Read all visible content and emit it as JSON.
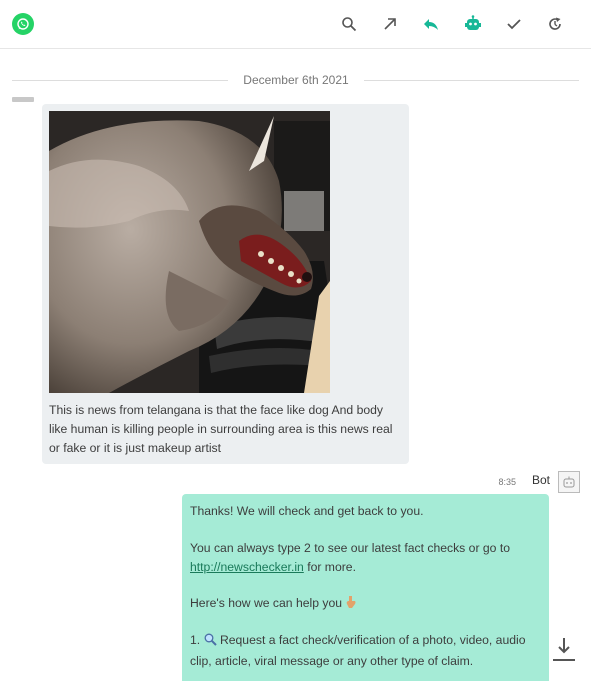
{
  "toolbar": {
    "app_icon": "whatsapp-icon",
    "icons": [
      "search-icon",
      "open-external-icon",
      "reply-icon",
      "bot-icon",
      "check-icon",
      "refresh-icon"
    ],
    "accent_color": "#25d366",
    "active_icon_color": "#17b897"
  },
  "conversation": {
    "date": "December 6th 2021",
    "incoming": {
      "image_description": "photo",
      "text": "This is news from telangana is that the face like dog And body like human is killing people in surrounding area is this news real or fake or it is just makeup artist"
    },
    "reply": {
      "time": "8:35",
      "sender": "Bot",
      "line1": "Thanks! We will check and get back to you.",
      "line2_pre": "You can always type 2 to see our latest fact checks or go to ",
      "link": "http://newschecker.in",
      "line2_post": " for more.",
      "line3": "Here's how we can help you",
      "line4_num": "1.",
      "line4_text": " Request a fact check/verification of a photo, video, audio clip, article, viral message or any other type of claim.",
      "bubble_color": "#a5ebd6"
    }
  }
}
